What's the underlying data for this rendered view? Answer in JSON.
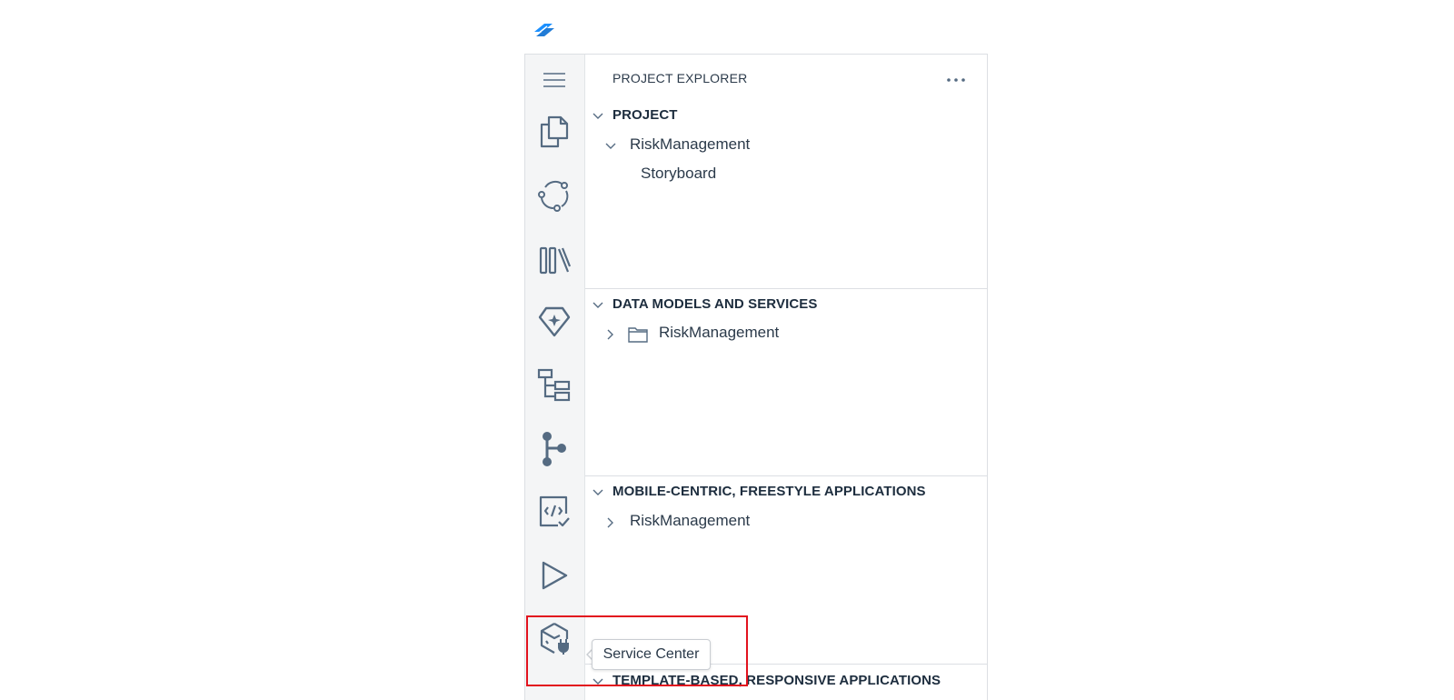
{
  "explorer": {
    "title": "PROJECT EXPLORER",
    "more_label": "⋯"
  },
  "activity_bar": {
    "items": [
      {
        "icon": "menu-icon"
      },
      {
        "icon": "files-icon"
      },
      {
        "icon": "source-control-icon"
      },
      {
        "icon": "library-icon"
      },
      {
        "icon": "gem-icon"
      },
      {
        "icon": "tree-structure-icon"
      },
      {
        "icon": "git-branch-icon"
      },
      {
        "icon": "code-check-icon"
      },
      {
        "icon": "run-icon"
      },
      {
        "icon": "service-center-icon"
      }
    ]
  },
  "sections": [
    {
      "title": "PROJECT",
      "expanded": true,
      "items": [
        {
          "label": "RiskManagement",
          "expanded": true
        },
        {
          "label": "Storyboard"
        }
      ]
    },
    {
      "title": "DATA MODELS AND SERVICES",
      "expanded": true,
      "items": [
        {
          "label": "RiskManagement",
          "expanded": false,
          "icon": "folder-icon"
        }
      ]
    },
    {
      "title": "MOBILE-CENTRIC, FREESTYLE APPLICATIONS",
      "expanded": true,
      "items": [
        {
          "label": "RiskManagement",
          "expanded": false
        }
      ]
    },
    {
      "title": "TEMPLATE-BASED, RESPONSIVE APPLICATIONS",
      "expanded": true,
      "items": []
    }
  ],
  "tooltip": {
    "text": "Service Center"
  },
  "colors": {
    "highlight": "#e2131e",
    "logo_blue": "#1b90ff",
    "icon_gray": "#556b82"
  }
}
